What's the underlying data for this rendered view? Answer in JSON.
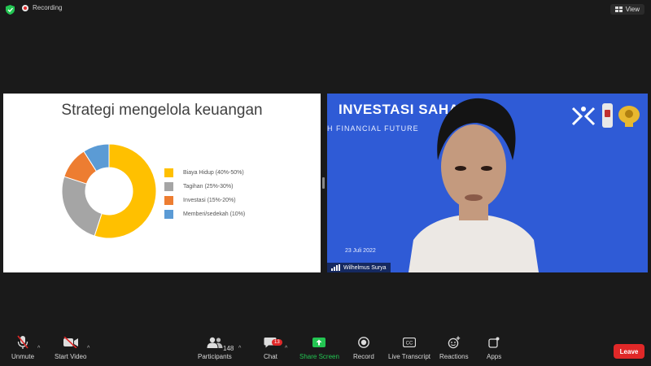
{
  "topbar": {
    "recording_label": "Recording",
    "view_label": "View"
  },
  "slide": {
    "title": "Strategi mengelola keuangan"
  },
  "chart_data": {
    "type": "pie",
    "title": "Strategi mengelola keuangan",
    "categories": [
      "Biaya Hidup (40%-50%)",
      "Tagihan (25%-30%)",
      "Investasi (15%-20%)",
      "Memberi/sedekah (10%)"
    ],
    "values": [
      55,
      25,
      11,
      9
    ],
    "colors": [
      "#ffc000",
      "#a5a5a5",
      "#ed7d31",
      "#5b9bd5"
    ],
    "legend": "right"
  },
  "video": {
    "banner": "INVESTASI SAHAM",
    "subtitle": "H FINANCIAL FUTURE",
    "date": "23 Juli 2022",
    "participant_name": "Wilhelmus Surya"
  },
  "toolbar": {
    "unmute": "Unmute",
    "start_video": "Start Video",
    "participants": "Participants",
    "participants_count": "148",
    "chat": "Chat",
    "chat_badge": "13",
    "share_screen": "Share Screen",
    "record": "Record",
    "live_transcript": "Live Transcript",
    "reactions": "Reactions",
    "apps": "Apps",
    "leave": "Leave",
    "cc_glyph": "CC"
  }
}
